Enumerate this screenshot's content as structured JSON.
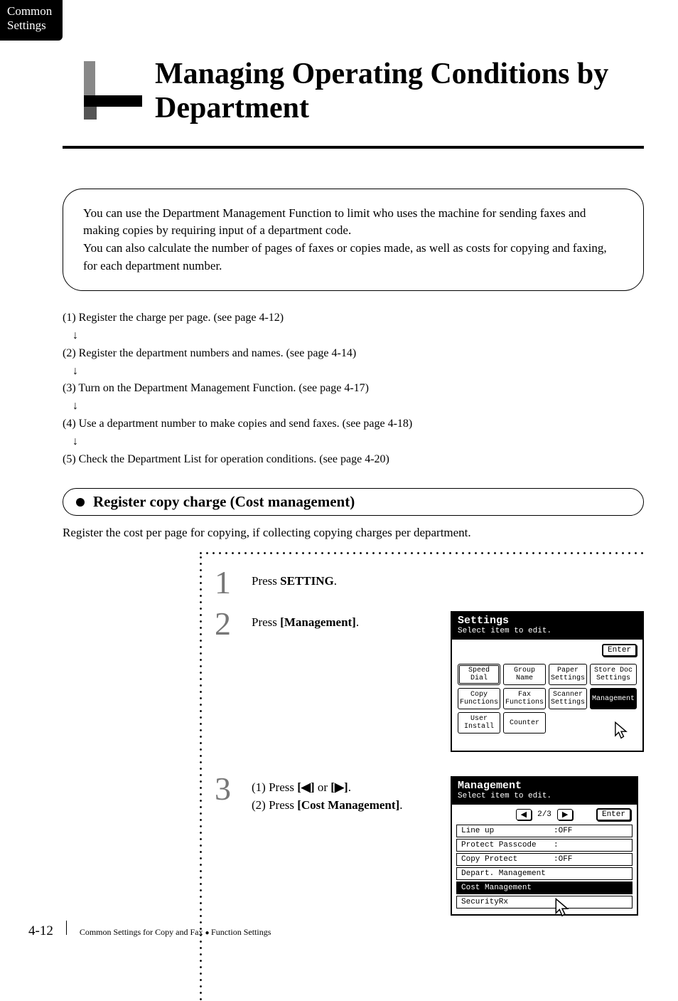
{
  "tab": {
    "line1": "Common",
    "line2": "Settings"
  },
  "title": "Managing Operating Conditions by Department",
  "intro": "You can use the Department Management Function to limit who uses the machine for sending faxes and making copies by requiring input of a department code.\nYou can also calculate the number of pages of faxes or copies made, as well as costs for copying and faxing, for each department number.",
  "outline": [
    "(1) Register the charge per page. (see page 4-12)",
    "↓",
    "(2) Register the department numbers and names. (see page 4-14)",
    "↓",
    "(3) Turn on the Department Management Function. (see page 4-17)",
    "↓",
    "(4) Use a department number to make copies and send faxes. (see page 4-18)",
    "↓",
    "(5) Check the Department List for operation conditions. (see page 4-20)"
  ],
  "section_heading": "Register copy charge (Cost management)",
  "section_intro": "Register the cost per page for copying, if collecting copying charges per department.",
  "steps": {
    "s1": {
      "num": "1",
      "pre": "Press ",
      "bold": "SETTING",
      "post": "."
    },
    "s2": {
      "num": "2",
      "pre": "Press ",
      "bold": "[Management]",
      "post": "."
    },
    "s3": {
      "num": "3",
      "l1_pre": "(1) Press ",
      "l1_bold_a": "[◀]",
      "l1_mid": " or ",
      "l1_bold_b": "[▶]",
      "l1_post": ".",
      "l2_pre": "(2) Press ",
      "l2_bold": "[Cost Management]",
      "l2_post": "."
    }
  },
  "screen1": {
    "title": "Settings",
    "subtitle": "Select item to edit.",
    "enter": "Enter",
    "buttons": [
      "Speed Dial",
      "Group Name",
      "Paper\nSettings",
      "Store Doc\nSettings",
      "Copy\nFunctions",
      "Fax\nFunctions",
      "Scanner\nSettings",
      "Management",
      "User\nInstall",
      "Counter"
    ]
  },
  "screen2": {
    "title": "Management",
    "subtitle": "Select item to edit.",
    "left": "◀",
    "page": "2/3",
    "right": "▶",
    "enter": "Enter",
    "rows": [
      {
        "label": "Line up",
        "value": ":OFF"
      },
      {
        "label": "Protect Passcode",
        "value": ":"
      },
      {
        "label": "Copy Protect",
        "value": ":OFF"
      },
      {
        "label": "Depart. Management",
        "value": ""
      },
      {
        "label": "Cost Management",
        "value": "",
        "selected": true
      },
      {
        "label": "SecurityRx",
        "value": ""
      }
    ]
  },
  "footer": {
    "page": "4-12",
    "text_a": "Common Settings for Copy and Fax",
    "text_b": "Function Settings"
  }
}
